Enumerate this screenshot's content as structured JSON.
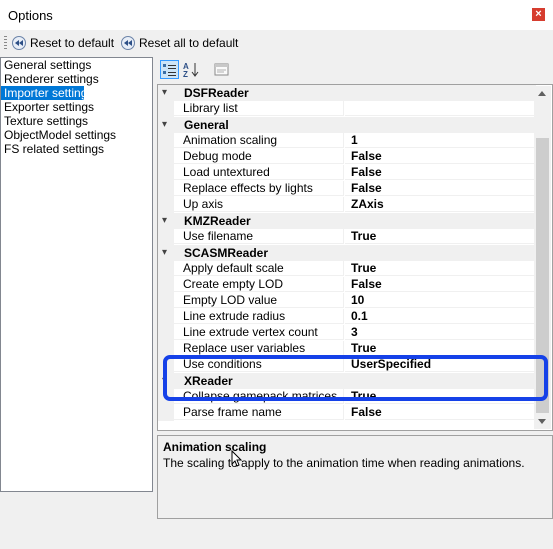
{
  "window": {
    "title": "Options",
    "close_glyph": "×"
  },
  "toolbar": {
    "reset_label": "Reset to default",
    "reset_all_label": "Reset all to default"
  },
  "sidebar": {
    "items": [
      {
        "label": "General settings"
      },
      {
        "label": "Renderer settings"
      },
      {
        "label": "Importer settings",
        "selected": true
      },
      {
        "label": "Exporter settings"
      },
      {
        "label": "Texture settings"
      },
      {
        "label": "ObjectModel settings"
      },
      {
        "label": "FS related settings"
      }
    ]
  },
  "grid": {
    "rows": [
      {
        "type": "category",
        "label": "DSFReader"
      },
      {
        "type": "property",
        "name": "Library list",
        "value": ""
      },
      {
        "type": "category",
        "label": "General"
      },
      {
        "type": "property",
        "name": "Animation scaling",
        "value": "1"
      },
      {
        "type": "property",
        "name": "Debug mode",
        "value": "False"
      },
      {
        "type": "property",
        "name": "Load untextured",
        "value": "False"
      },
      {
        "type": "property",
        "name": "Replace effects by lights",
        "value": "False"
      },
      {
        "type": "property",
        "name": "Up axis",
        "value": "ZAxis"
      },
      {
        "type": "category",
        "label": "KMZReader"
      },
      {
        "type": "property",
        "name": "Use filename",
        "value": "True"
      },
      {
        "type": "category",
        "label": "SCASMReader"
      },
      {
        "type": "property",
        "name": "Apply default scale",
        "value": "True"
      },
      {
        "type": "property",
        "name": "Create empty LOD",
        "value": "False"
      },
      {
        "type": "property",
        "name": "Empty LOD value",
        "value": "10"
      },
      {
        "type": "property",
        "name": "Line extrude radius",
        "value": "0.1"
      },
      {
        "type": "property",
        "name": "Line extrude vertex count",
        "value": "3"
      },
      {
        "type": "property",
        "name": "Replace user variables",
        "value": "True"
      },
      {
        "type": "property",
        "name": "Use conditions",
        "value": "UserSpecified"
      },
      {
        "type": "category",
        "label": "XReader"
      },
      {
        "type": "property",
        "name": "Collapse gamepack matrices",
        "value": "True"
      },
      {
        "type": "property",
        "name": "Parse frame name",
        "value": "False"
      }
    ],
    "collapse_glyph": "▾"
  },
  "help": {
    "title": "Animation scaling",
    "description": "The scaling to apply to the animation time when reading animations."
  },
  "colors": {
    "selection": "#0078d7",
    "highlight_box": "#1541e8"
  }
}
